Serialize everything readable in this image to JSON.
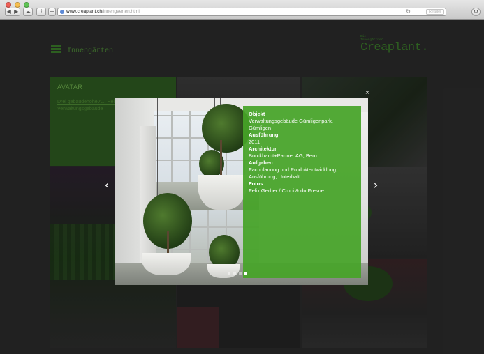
{
  "browser": {
    "url_host": "www.creaplant.ch",
    "url_path": "/innengaerten.html",
    "reader_label": "Reader",
    "back_icon": "chevron-left-icon",
    "forward_icon": "chevron-right-icon"
  },
  "header": {
    "page_title": "Innengärten",
    "logo_small_line1": "Die",
    "logo_small_line2": "Innengärtner",
    "logo_name": "Creaplant."
  },
  "tiles": {
    "avatar_label": "AVATAR",
    "avatar_desc": "Drei gebäudehohe A... Helligkeit und Luft in Verwaltungsgebäude"
  },
  "lightbox": {
    "fields": [
      {
        "heading": "Objekt",
        "value": "Verwaltungsgebäude Gümligenpark, Gümligen"
      },
      {
        "heading": "Ausführung",
        "value": "2011"
      },
      {
        "heading": "Architektur",
        "value": "Burckhardt+Partner AG, Bern"
      },
      {
        "heading": "Aufgaben",
        "value": "Fachplanung und Produktentwicklung, Ausführung, Unterhalt"
      },
      {
        "heading": "Fotos",
        "value": "Felix Gerber / Croci & du Fresne"
      }
    ],
    "close_label": "×",
    "prev_label": "‹",
    "next_label": "›",
    "slide_count": 4,
    "active_slide": 4
  },
  "colors": {
    "accent": "#46a428",
    "brand_dark": "#3a7a2a",
    "background": "#2b2b2b"
  }
}
